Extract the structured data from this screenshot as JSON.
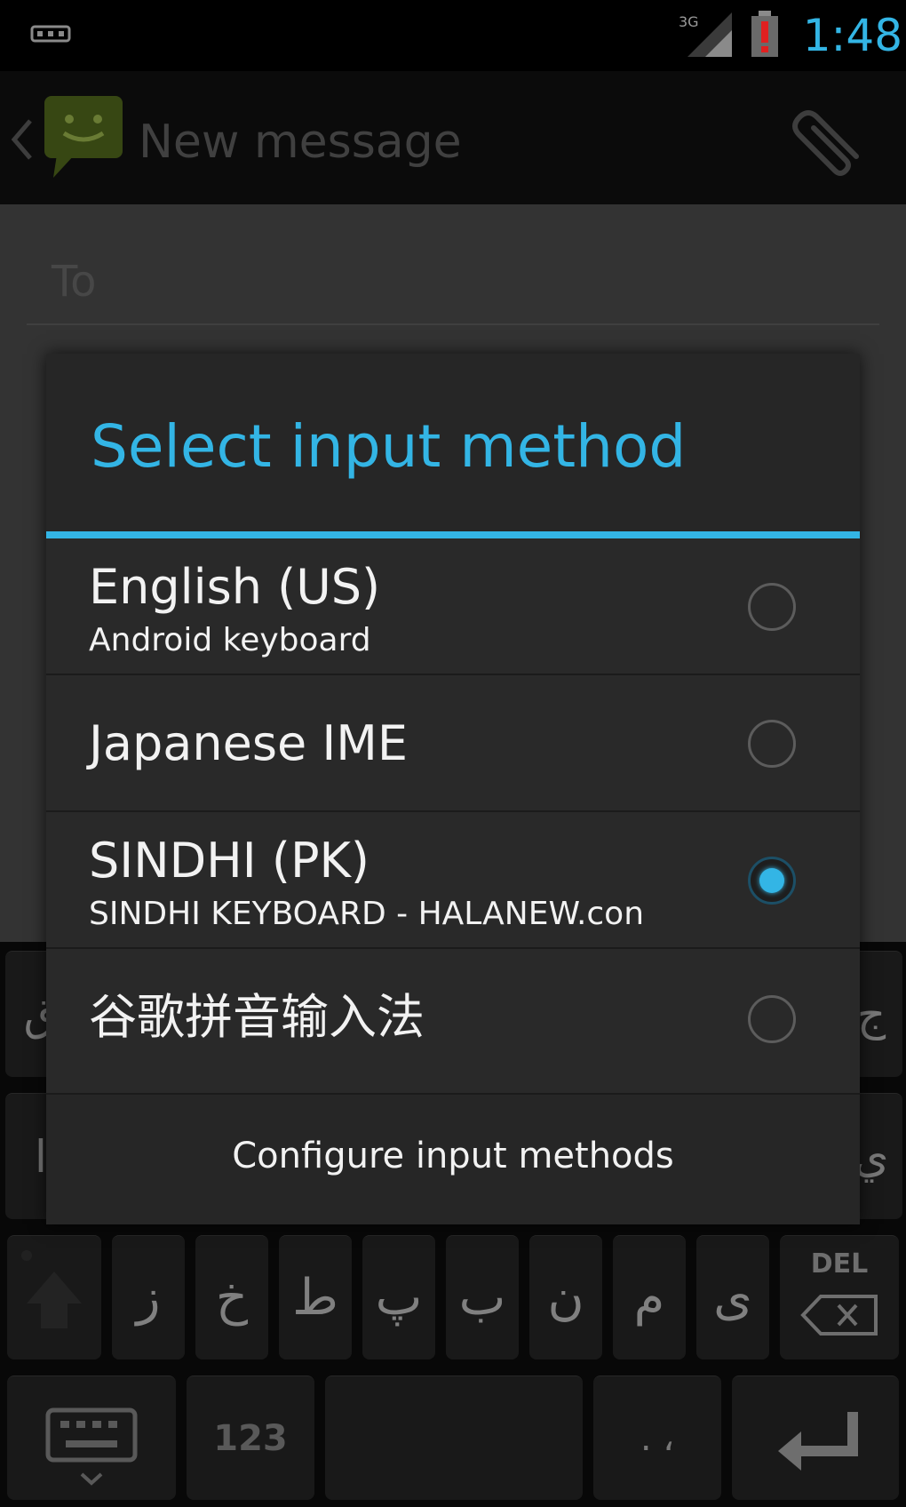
{
  "status_bar": {
    "time": "1:48",
    "network": "3G",
    "icons": [
      "notification-icon",
      "signal-3g-icon",
      "battery-alert-icon"
    ],
    "time_color": "#33b5e5"
  },
  "action_bar": {
    "title": "New message",
    "icons": [
      "back-chevron-icon",
      "messaging-app-icon",
      "attach-paperclip-icon"
    ]
  },
  "compose": {
    "to_placeholder": "To"
  },
  "dialog": {
    "title": "Select input method",
    "accent_color": "#33b5e5",
    "options": [
      {
        "label": "English (US)",
        "sublabel": "Android keyboard",
        "selected": false
      },
      {
        "label": "Japanese IME",
        "sublabel": "",
        "selected": false
      },
      {
        "label": "SINDHI (PK)",
        "sublabel": "SINDHI KEYBOARD - HALANEW.con",
        "selected": true
      },
      {
        "label": "谷歌拼音输入法",
        "sublabel": "",
        "selected": false
      }
    ],
    "configure_label": "Configure input methods"
  },
  "keyboard": {
    "row_partial_left_1": "ق",
    "row_partial_right_1": "ج",
    "row_partial_left_2": "ا",
    "row_partial_right_2": "ي",
    "bottom_letter_keys": [
      "ز",
      "خ",
      "ط",
      "پ",
      "ب",
      "ن",
      "م",
      "ى"
    ],
    "del_label": "DEL",
    "numbers_label": "123",
    "punct_label": ". ،",
    "icons": [
      "shift-icon",
      "backspace-icon",
      "keyboard-switch-icon",
      "enter-icon"
    ]
  }
}
